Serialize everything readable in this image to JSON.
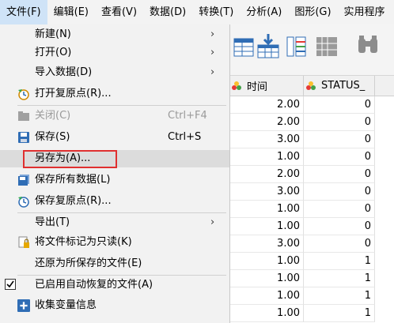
{
  "menubar": {
    "items": [
      "文件(F)",
      "编辑(E)",
      "查看(V)",
      "数据(D)",
      "转换(T)",
      "分析(A)",
      "图形(G)",
      "实用程序"
    ]
  },
  "grid": {
    "headers": [
      "时间",
      "STATUS_"
    ],
    "rows": [
      [
        "2.00",
        "0"
      ],
      [
        "2.00",
        "0"
      ],
      [
        "3.00",
        "0"
      ],
      [
        "1.00",
        "0"
      ],
      [
        "2.00",
        "0"
      ],
      [
        "3.00",
        "0"
      ],
      [
        "1.00",
        "0"
      ],
      [
        "1.00",
        "0"
      ],
      [
        "3.00",
        "0"
      ],
      [
        "1.00",
        "1"
      ],
      [
        "1.00",
        "1"
      ],
      [
        "1.00",
        "1"
      ],
      [
        "1.00",
        "1"
      ]
    ]
  },
  "file_menu": {
    "new": "新建(N)",
    "open": "打开(O)",
    "import": "导入数据(D)",
    "open_restore": "打开复原点(R)...",
    "close": "关闭(C)",
    "close_shortcut": "Ctrl+F4",
    "save": "保存(S)",
    "save_shortcut": "Ctrl+S",
    "save_as": "另存为(A)...",
    "save_all": "保存所有数据(L)",
    "save_restore": "保存复原点(R)...",
    "export": "导出(T)",
    "mark_readonly": "将文件标记为只读(K)",
    "revert": "还原为所保存的文件(E)",
    "auto_recover": "已启用自动恢复的文件(A)",
    "collect_var": "收集变量信息"
  },
  "colors": {
    "highlight_border": "#e03030",
    "menu_bg": "#f2f2f2",
    "hover_bg": "#dcdcdc",
    "icon_blue": "#2f6db5",
    "icon_gray": "#8c8c8c"
  }
}
